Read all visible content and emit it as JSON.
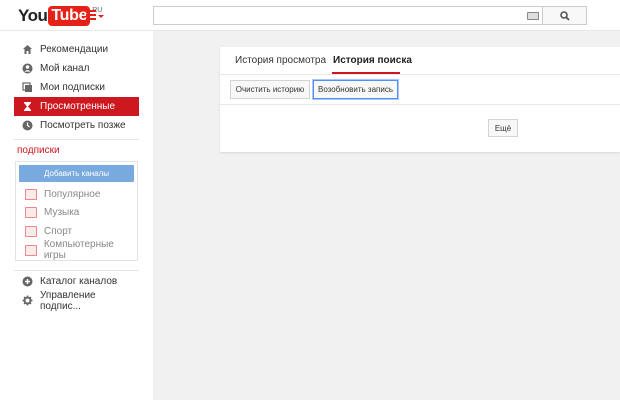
{
  "header": {
    "logo_you": "You",
    "logo_tube": "Tube",
    "logo_region": "RU",
    "search": {
      "value": "",
      "placeholder": ""
    },
    "keyboard_icon": "keyboard-icon",
    "search_icon": "search-icon"
  },
  "sidebar": {
    "items": [
      {
        "label": "Рекомендации",
        "icon": "home-icon"
      },
      {
        "label": "Мой канал",
        "icon": "user-icon"
      },
      {
        "label": "Мои подписки",
        "icon": "subscriptions-icon"
      },
      {
        "label": "Просмотренные",
        "icon": "hourglass-icon",
        "active": true
      },
      {
        "label": "Посмотреть позже",
        "icon": "clock-icon"
      }
    ],
    "subscriptions_title": "подписки",
    "add_channels_label": "Добавить каналы",
    "subscriptions": [
      {
        "label": "Популярное",
        "icon": "popular-icon"
      },
      {
        "label": "Музыка",
        "icon": "headphones-icon"
      },
      {
        "label": "Спорт",
        "icon": "trophy-icon"
      },
      {
        "label": "Компьютерные игры",
        "icon": "gamepad-icon"
      }
    ],
    "bottom_items": [
      {
        "label": "Каталог каналов",
        "icon": "plus-circle-icon"
      },
      {
        "label": "Управление подпис...",
        "icon": "gear-icon"
      }
    ]
  },
  "main": {
    "tabs": [
      {
        "label": "История просмотра",
        "active": false
      },
      {
        "label": "История поиска",
        "active": true
      }
    ],
    "clear_history_label": "Очистить историю",
    "resume_recording_label": "Возобновить запись",
    "more_label": "Ещё"
  },
  "colors": {
    "brand_red": "#cc181e",
    "add_channels_blue": "#78aadf"
  }
}
